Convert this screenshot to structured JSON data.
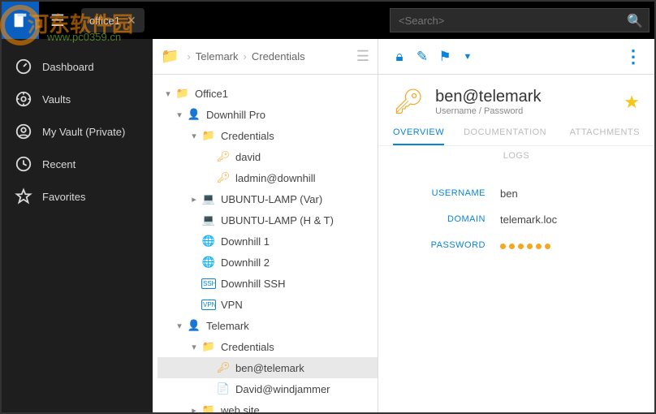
{
  "top": {
    "tab_label": "office1",
    "search_placeholder": "<Search>"
  },
  "nav": [
    {
      "label": "Dashboard",
      "icon": "dash"
    },
    {
      "label": "Vaults",
      "icon": "vault"
    },
    {
      "label": "My Vault (Private)",
      "icon": "myvault"
    },
    {
      "label": "Recent",
      "icon": "recent"
    },
    {
      "label": "Favorites",
      "icon": "star"
    }
  ],
  "breadcrumb": [
    "Telemark",
    "Credentials"
  ],
  "tree": [
    {
      "d": 0,
      "chev": "v",
      "ic": "folder",
      "label": "Office1"
    },
    {
      "d": 1,
      "chev": "v",
      "ic": "user",
      "label": "Downhill Pro"
    },
    {
      "d": 2,
      "chev": "v",
      "ic": "cred",
      "label": "Credentials"
    },
    {
      "d": 3,
      "chev": "",
      "ic": "key",
      "label": "david"
    },
    {
      "d": 3,
      "chev": "",
      "ic": "key",
      "label": "ladmin@downhill"
    },
    {
      "d": 2,
      "chev": ">",
      "ic": "serv",
      "label": "UBUNTU-LAMP (Var)"
    },
    {
      "d": 2,
      "chev": "",
      "ic": "serv",
      "label": "UBUNTU-LAMP (H & T)"
    },
    {
      "d": 2,
      "chev": "",
      "ic": "web",
      "label": "Downhill 1"
    },
    {
      "d": 2,
      "chev": "",
      "ic": "web",
      "label": "Downhill 2"
    },
    {
      "d": 2,
      "chev": "",
      "ic": "ssh",
      "label": "Downhill SSH"
    },
    {
      "d": 2,
      "chev": "",
      "ic": "vpn",
      "label": "VPN"
    },
    {
      "d": 1,
      "chev": "v",
      "ic": "user",
      "label": "Telemark"
    },
    {
      "d": 2,
      "chev": "v",
      "ic": "cred",
      "label": "Credentials"
    },
    {
      "d": 3,
      "chev": "",
      "ic": "key",
      "label": "ben@telemark",
      "sel": true
    },
    {
      "d": 3,
      "chev": "",
      "ic": "doc",
      "label": "David@windjammer"
    },
    {
      "d": 2,
      "chev": ">",
      "ic": "cred",
      "label": "web site"
    }
  ],
  "entry": {
    "title": "ben@telemark",
    "subtitle": "Username / Password",
    "tabs": [
      "OVERVIEW",
      "DOCUMENTATION",
      "ATTACHMENTS"
    ],
    "tabs2": "LOGS",
    "fields": {
      "username_label": "USERNAME",
      "username": "ben",
      "domain_label": "DOMAIN",
      "domain": "telemark.loc",
      "password_label": "PASSWORD",
      "password_dots": 6
    }
  },
  "watermark": {
    "text": "河东软件园",
    "url": "www.pc0359.cn"
  }
}
